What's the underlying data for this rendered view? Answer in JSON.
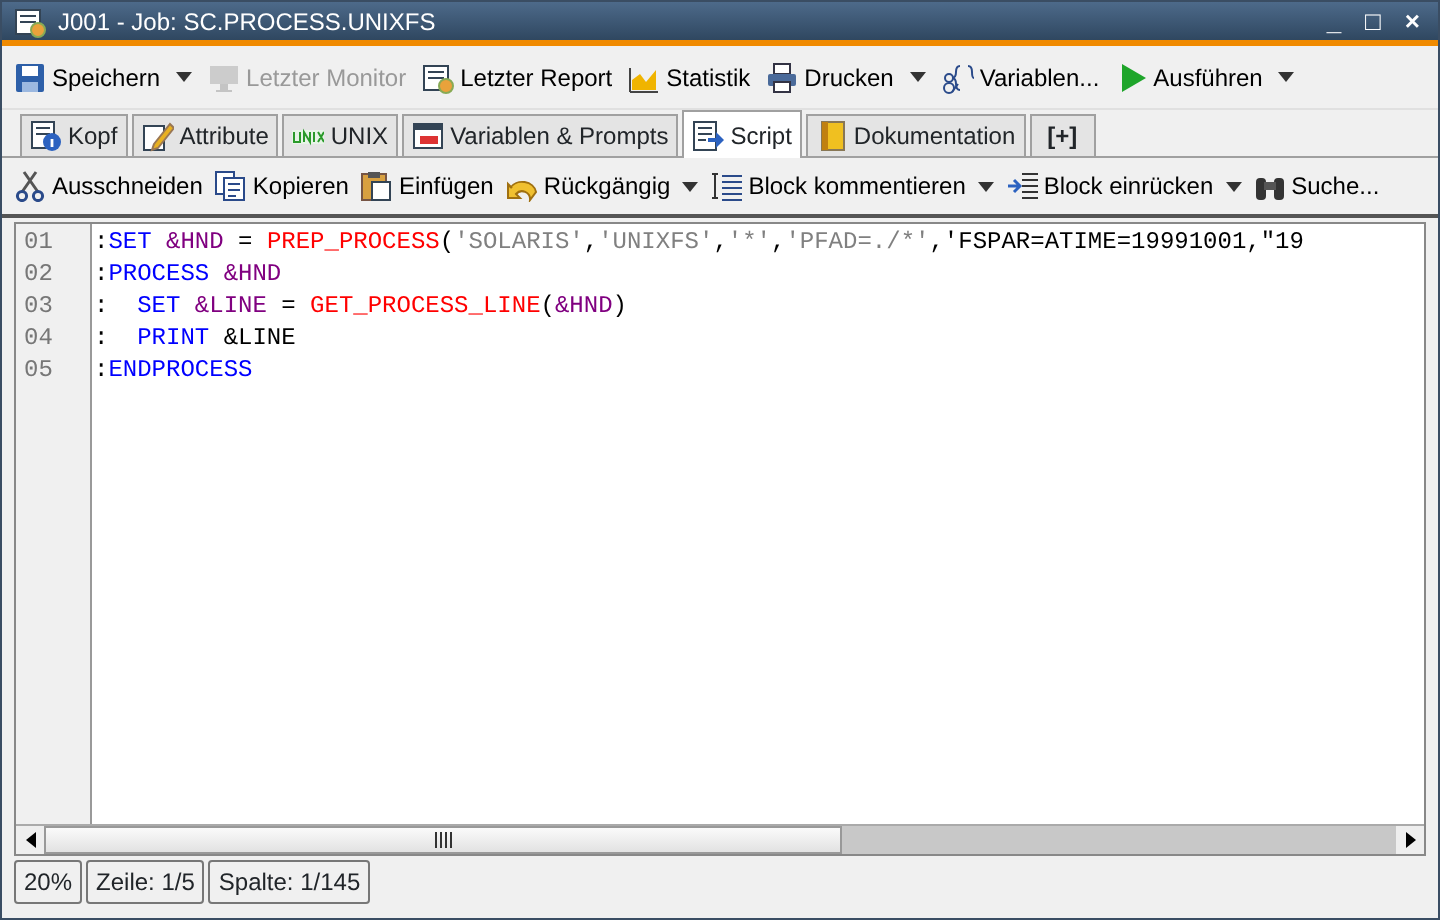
{
  "window": {
    "title": "J001 - Job: SC.PROCESS.UNIXFS",
    "controls": [
      "_",
      "□",
      "×"
    ]
  },
  "toolbar": [
    {
      "label": "Speichern",
      "disabled": false,
      "dropdown": true
    },
    {
      "label": "Letzter Monitor",
      "disabled": true,
      "dropdown": false
    },
    {
      "label": "Letzter Report",
      "disabled": false,
      "dropdown": false
    },
    {
      "label": "Statistik",
      "disabled": false,
      "dropdown": false
    },
    {
      "label": "Drucken",
      "disabled": false,
      "dropdown": true
    },
    {
      "label": "Variablen...",
      "disabled": false,
      "dropdown": false
    },
    {
      "label": "Ausführen",
      "disabled": false,
      "dropdown": true
    }
  ],
  "tabs": [
    {
      "label": "Kopf",
      "selected": false
    },
    {
      "label": "Attribute",
      "selected": false
    },
    {
      "label": "UNIX",
      "selected": false
    },
    {
      "label": "Variablen & Prompts",
      "selected": false
    },
    {
      "label": "Script",
      "selected": true
    },
    {
      "label": "Dokumentation",
      "selected": false
    },
    {
      "label": "[+]",
      "selected": false
    }
  ],
  "edit_toolbar": [
    {
      "label": "Ausschneiden",
      "dropdown": false
    },
    {
      "label": "Kopieren",
      "dropdown": false
    },
    {
      "label": "Einfügen",
      "dropdown": false
    },
    {
      "label": "Rückgängig",
      "dropdown": true
    },
    {
      "label": "Block kommentieren",
      "dropdown": true
    },
    {
      "label": "Block einrücken",
      "dropdown": true
    },
    {
      "label": "Suche...",
      "dropdown": false
    }
  ],
  "editor": {
    "lines": [
      {
        "number": "01",
        "tokens": [
          {
            "kind": "plain",
            "text": ":"
          },
          {
            "kind": "keyword",
            "text": "SET "
          },
          {
            "kind": "variable",
            "text": "&HND"
          },
          {
            "kind": "plain",
            "text": " = "
          },
          {
            "kind": "function",
            "text": "PREP_PROCESS"
          },
          {
            "kind": "plain",
            "text": "("
          },
          {
            "kind": "string",
            "text": "'SOLARIS'"
          },
          {
            "kind": "plain",
            "text": ","
          },
          {
            "kind": "string",
            "text": "'UNIXFS'"
          },
          {
            "kind": "plain",
            "text": ","
          },
          {
            "kind": "string",
            "text": "'*'"
          },
          {
            "kind": "plain",
            "text": ","
          },
          {
            "kind": "string",
            "text": "'PFAD=./*'"
          },
          {
            "kind": "plain",
            "text": ",'FSPAR=ATIME=19991001,\"19"
          }
        ]
      },
      {
        "number": "02",
        "tokens": [
          {
            "kind": "plain",
            "text": ":"
          },
          {
            "kind": "keyword",
            "text": "PROCESS "
          },
          {
            "kind": "variable",
            "text": "&HND"
          }
        ]
      },
      {
        "number": "03",
        "tokens": [
          {
            "kind": "plain",
            "text": ":  "
          },
          {
            "kind": "keyword",
            "text": "SET "
          },
          {
            "kind": "variable",
            "text": "&LINE"
          },
          {
            "kind": "plain",
            "text": " = "
          },
          {
            "kind": "function",
            "text": "GET_PROCESS_LINE"
          },
          {
            "kind": "plain",
            "text": "("
          },
          {
            "kind": "variable",
            "text": "&HND"
          },
          {
            "kind": "plain",
            "text": ")"
          }
        ]
      },
      {
        "number": "04",
        "tokens": [
          {
            "kind": "plain",
            "text": ":  "
          },
          {
            "kind": "keyword",
            "text": "PRINT "
          },
          {
            "kind": "plain",
            "text": "&LINE"
          }
        ]
      },
      {
        "number": "05",
        "tokens": [
          {
            "kind": "plain",
            "text": ":"
          },
          {
            "kind": "keyword",
            "text": "ENDPROCESS"
          }
        ]
      }
    ]
  },
  "status_bar": [
    "20%",
    "Zeile: 1/5",
    "Spalte: 1/145"
  ]
}
